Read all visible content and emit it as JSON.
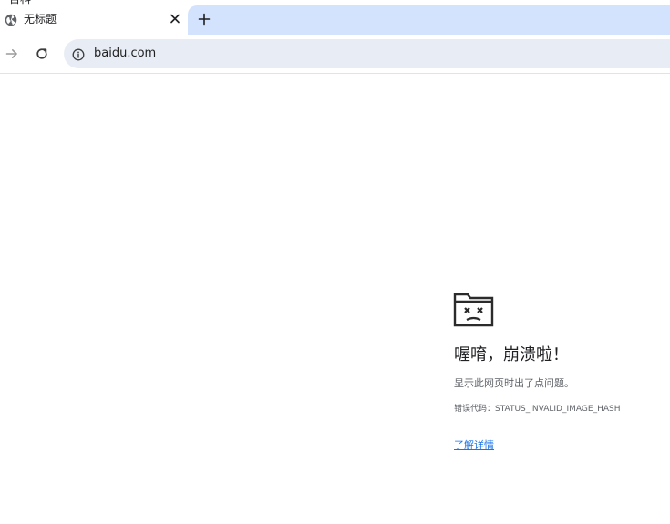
{
  "window": {
    "title": "百科"
  },
  "tab": {
    "favicon": "globe-icon",
    "title": "无标题",
    "close_icon": "close-icon"
  },
  "new_tab": {
    "icon": "plus-icon",
    "label": "+"
  },
  "toolbar": {
    "forward_icon": "arrow-right-icon",
    "reload_icon": "reload-icon",
    "info_icon": "info-icon",
    "url": "baidu.com"
  },
  "error": {
    "icon": "sad-folder-icon",
    "heading": "喔唷，崩溃啦！",
    "description": "显示此网页时出了点问题。",
    "code": "错误代码：STATUS_INVALID_IMAGE_HASH",
    "learn_more": "了解详情"
  },
  "colors": {
    "tab_strip": "#d3e3fd",
    "omnibox": "#e8edf5",
    "link": "#1a73e8",
    "text": "#202124",
    "muted": "#5f6368"
  }
}
